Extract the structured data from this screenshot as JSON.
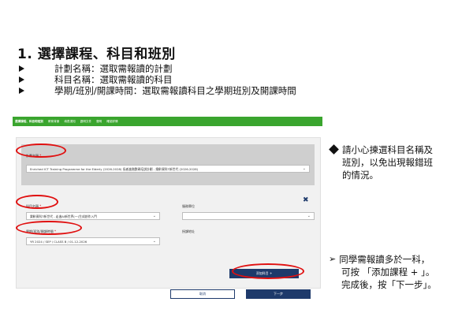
{
  "heading": "1. 選擇課程、科目和班別",
  "bullets": [
    "計劃名稱：選取需報讀的計劃",
    "科目名稱：選取需報讀的科目",
    "學期/班別/開課時間：選取需報讀科目之學期班別及開課時間"
  ],
  "screenshot": {
    "nav": [
      "選擇課程、科目和班別",
      "教育背景",
      "填表須知",
      "證明文件",
      "聲明",
      "確認詳情"
    ],
    "plan": {
      "label": "計劃名稱",
      "value": "Enriched ICT Training Programme for the Elderly (2026-2028) 長者進階數碼培訓計劃 - 樂齡資科T新世代 (2026-2028)"
    },
    "subject": {
      "label": "科目名稱",
      "value": "樂齡資科T新世代 - 走進AI新世界(一)生成創作入門"
    },
    "service_centre": {
      "label": "服務單位",
      "value": ""
    },
    "term": {
      "label": "學期/班別/開課時間",
      "value": "YR 2024 / SEP / CLASS B / 01-12-2026"
    },
    "address": {
      "label": "授課地址",
      "value": ""
    },
    "required_mark": "*",
    "remove_icon": "✖",
    "add_button": "添加科目 +",
    "cancel_button": "取消",
    "next_button": "下一步"
  },
  "note1": [
    "請小心揀選科目名稱及",
    "班別，以免出現報錯班",
    "的情況。"
  ],
  "note2": [
    "同學需報讀多於一科，",
    "可按 「添加課程 + 」。",
    "完成後，按「下一步」。"
  ],
  "note2_pointer": "➢",
  "colors": {
    "green": "#3aa52e",
    "navy": "#1e3a6b",
    "highlight": "#e01010"
  }
}
